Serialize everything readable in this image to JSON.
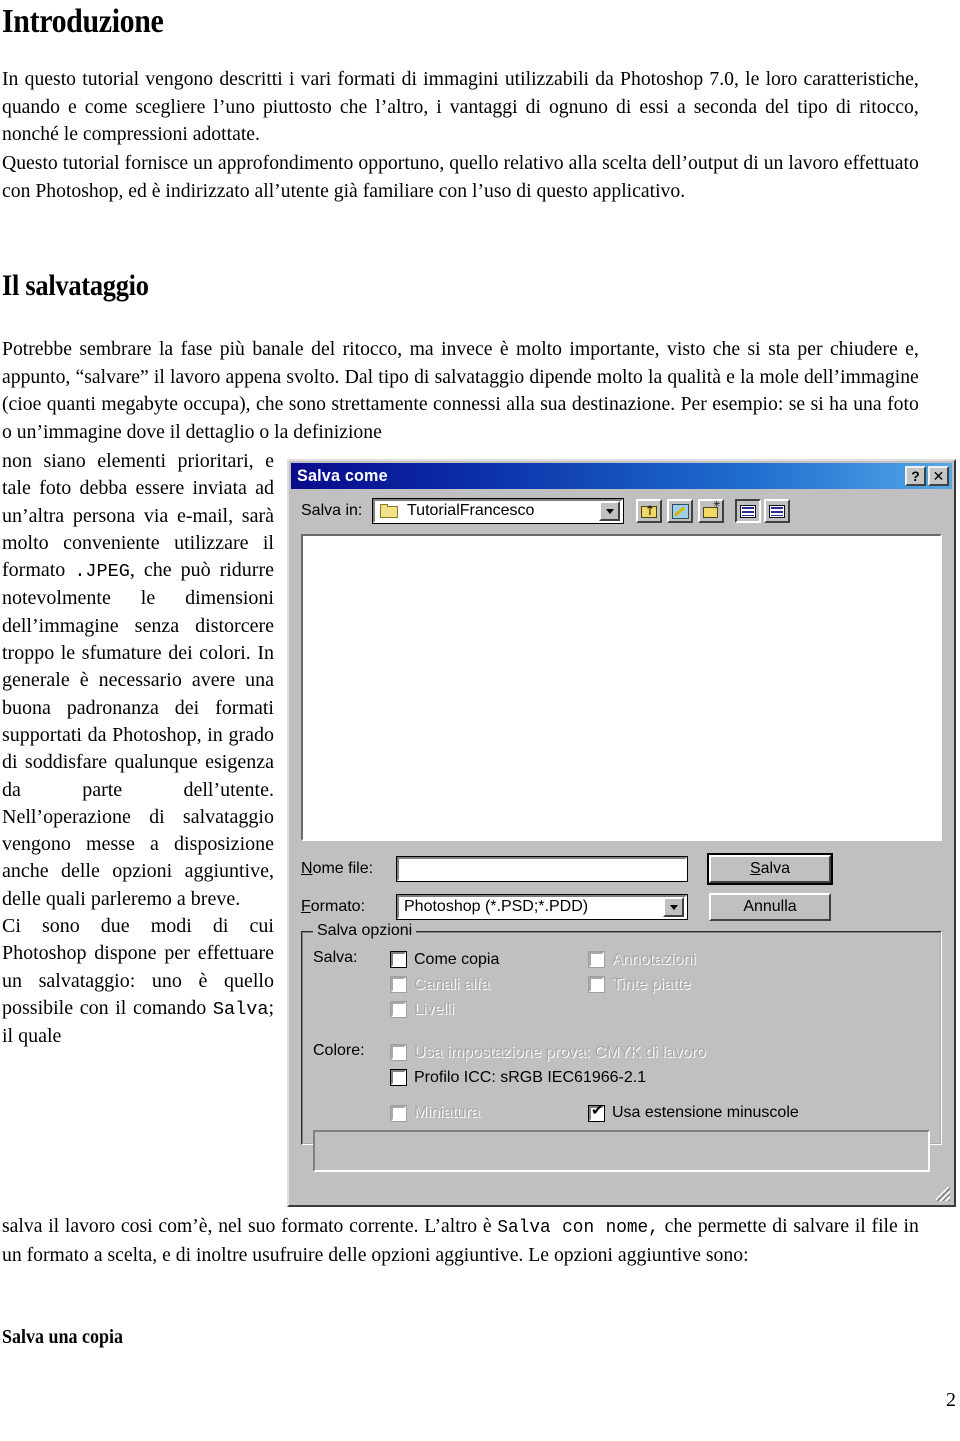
{
  "document": {
    "heading_intro": "Introduzione",
    "para_intro_1": "In questo tutorial vengono descritti i vari formati di immagini utilizzabili da Photoshop 7.0, le loro caratteristiche, quando e come scegliere l’uno piuttosto che l’altro, i vantaggi di ognuno di essi a seconda del tipo di ritocco, nonché le compressioni adottate.",
    "para_intro_2": "Questo tutorial fornisce un approfondimento opportuno, quello relativo alla scelta dell’output di un lavoro effettuato con Photoshop, ed è indirizzato all’utente già familiare con l’uso di questo applicativo.",
    "heading_salvataggio": "Il salvataggio",
    "para_salv_1": "Potrebbe sembrare la fase più banale del ritocco, ma invece è molto importante, visto che si sta per chiudere e, appunto, “salvare” il lavoro appena svolto. Dal tipo di salvataggio dipende molto la qualità e la mole dell’immagine (cioe quanti megabyte occupa), che sono strettamente connessi alla sua destinazione. Per esempio:  se si ha una foto o un’immagine dove il dettaglio o la definizione",
    "col_left_a": "non siano elementi prioritari, e tale foto debba essere inviata ad un’altra persona via e-mail, sarà molto conveniente utilizzare il formato ",
    "col_left_mono_1": ".JPEG",
    "col_left_b": ", che può ridurre notevolmente le dimensioni dell’immagine senza distorcere troppo le sfumature dei colori. In generale è necessario avere una buona padronanza dei formati supportati da Photoshop, in grado di soddisfare qualunque esigenza da parte dell’utente. Nell’operazione di salvataggio vengono messe a disposizione anche delle opzioni aggiuntive, delle quali parleremo a breve.",
    "col_left_c": "Ci sono due modi di cui Photoshop dispone per effettuare un salvataggio: uno è quello possibile con il comando ",
    "col_left_mono_2": "Salva",
    "col_left_d": "; il quale",
    "para_tail_a": "salva il lavoro cosi com’è, nel suo formato corrente. L’altro è ",
    "para_tail_mono": "Salva con nome,",
    "para_tail_b": " che permette di salvare il file in un formato a scelta, e di inoltre usufruire delle opzioni aggiuntive. Le opzioni aggiuntive sono:",
    "subheading_salva_copia": "Salva una copia",
    "page_number": "2"
  },
  "dialog": {
    "title": "Salva come",
    "help_button": "?",
    "close_button": "✕",
    "look_in_label": "Salva in:",
    "look_in_value": "TutorialFrancesco",
    "toolbar": {
      "up_folder": "up-folder",
      "create_shortcut": "create-shortcut",
      "new_folder": "new-folder",
      "list_view": "list-view",
      "details_view": "details-view"
    },
    "filename_label": "Nome file:",
    "filename_value": "",
    "format_label": "Formato:",
    "format_value": "Photoshop (*.PSD;*.PDD)",
    "save_button": "Salva",
    "cancel_button": "Annulla",
    "options_group_title": "Salva opzioni",
    "save_row_label": "Salva:",
    "color_row_label": "Colore:",
    "checkboxes": {
      "come_copia": {
        "label": "Come copia",
        "checked": false,
        "enabled": true
      },
      "annotazioni": {
        "label": "Annotazioni",
        "checked": false,
        "enabled": false
      },
      "canali_alfa": {
        "label": "Canali alfa",
        "checked": false,
        "enabled": false
      },
      "tinte_piatte": {
        "label": "Tinte piatte",
        "checked": false,
        "enabled": false
      },
      "livelli": {
        "label": "Livelli",
        "checked": false,
        "enabled": false
      },
      "usa_impostazione": {
        "label": "Usa impostazione prova:  CMYK di lavoro",
        "checked": false,
        "enabled": false
      },
      "profilo_icc": {
        "label": "Profilo ICC:  sRGB IEC61966-2.1",
        "checked": false,
        "enabled": true
      },
      "miniatura": {
        "label": "Miniatura",
        "checked": false,
        "enabled": false
      },
      "usa_estensione": {
        "label": "Usa estensione minuscole",
        "checked": true,
        "enabled": true
      }
    }
  },
  "colors": {
    "dialog_face": "#c0c0c0",
    "titlebar_start": "#0a0a8c",
    "titlebar_end": "#52a8e8",
    "folder_yellow": "#f3e08a",
    "text": "#000000",
    "disabled_text": "#a8a8a8"
  }
}
